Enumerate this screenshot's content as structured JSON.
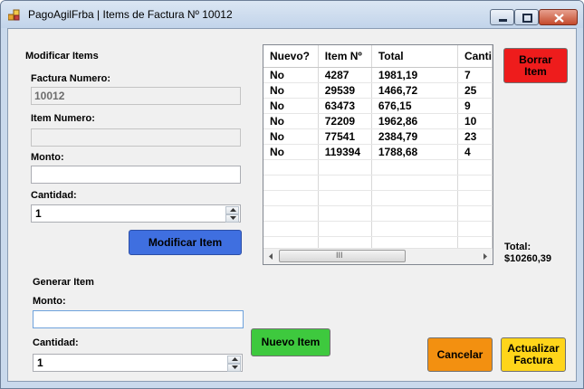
{
  "window": {
    "title": "PagoAgilFrba | Items de Factura Nº 10012"
  },
  "modificar": {
    "heading": "Modificar Items",
    "factura_label": "Factura Numero:",
    "factura_value": "10012",
    "item_label": "Item Numero:",
    "item_value": "",
    "monto_label": "Monto:",
    "monto_value": "",
    "cantidad_label": "Cantidad:",
    "cantidad_value": "1",
    "button": "Modificar Item"
  },
  "generar": {
    "heading": "Generar Item",
    "monto_label": "Monto:",
    "monto_value": "",
    "cantidad_label": "Cantidad:",
    "cantidad_value": "1"
  },
  "grid": {
    "columns": [
      "Nuevo?",
      "Item Nº",
      "Total",
      "Canti"
    ],
    "rows": [
      [
        "No",
        "4287",
        "1981,19",
        "7"
      ],
      [
        "No",
        "29539",
        "1466,72",
        "25"
      ],
      [
        "No",
        "63473",
        "676,15",
        "9"
      ],
      [
        "No",
        "72209",
        "1962,86",
        "10"
      ],
      [
        "No",
        "77541",
        "2384,79",
        "23"
      ],
      [
        "No",
        "119394",
        "1788,68",
        "4"
      ]
    ],
    "scroll_thumb": "III"
  },
  "total": {
    "label": "Total:",
    "value": "$10260,39"
  },
  "buttons": {
    "borrar": "Borrar Item",
    "nuevo": "Nuevo Item",
    "cancelar": "Cancelar",
    "actualizar": "Actualizar Factura"
  },
  "colors": {
    "modificar_button": "#3f6fe0",
    "borrar_button": "#ee1c1c",
    "nuevo_button": "#3ec93e",
    "cancelar_button": "#f39010",
    "actualizar_button": "#ffd51a"
  }
}
